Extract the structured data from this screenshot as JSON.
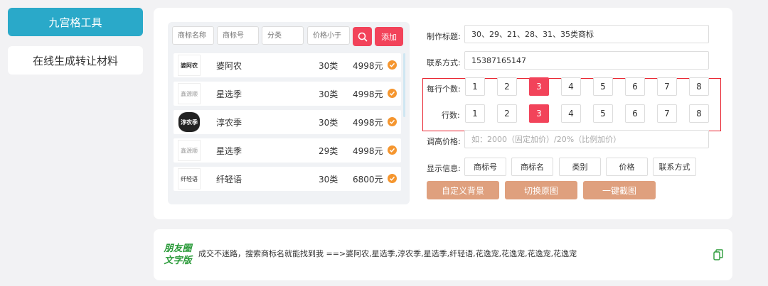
{
  "nav": {
    "grid_tool": "九宫格工具",
    "transfer_material": "在线生成转让材料"
  },
  "search": {
    "name_placeholder": "商标名称",
    "number_placeholder": "商标号",
    "category_placeholder": "分类",
    "price_placeholder": "价格小于",
    "add_label": "添加"
  },
  "trademarks": [
    {
      "logo": "婆阿农",
      "name": "婆阿农",
      "category": "30类",
      "price": "4998元"
    },
    {
      "logo": "鑫源顺",
      "name": "星选季",
      "category": "30类",
      "price": "4998元"
    },
    {
      "logo": "淳农季",
      "name": "淳农季",
      "category": "30类",
      "price": "4998元"
    },
    {
      "logo": "鑫源顺",
      "name": "星选季",
      "category": "29类",
      "price": "4998元"
    },
    {
      "logo": "纤轻语",
      "name": "纤轻语",
      "category": "30类",
      "price": "6800元"
    }
  ],
  "form": {
    "title_label": "制作标题:",
    "title_value": "30、29、21、28、31、35类商标",
    "contact_label": "联系方式:",
    "contact_value": "15387165147",
    "per_row_label": "每行个数:",
    "rows_label": "行数:",
    "numbers": [
      "1",
      "2",
      "3",
      "4",
      "5",
      "6",
      "7",
      "8"
    ],
    "per_row_selected": "3",
    "rows_selected": "3",
    "price_label": "调高价格:",
    "price_placeholder": "如：2000（固定加价）/20%（比例加价）",
    "display_label": "显示信息:",
    "display_options": [
      "商标号",
      "商标名",
      "类别",
      "价格",
      "联系方式"
    ],
    "actions": [
      "自定义背景",
      "切换原图",
      "一键截图"
    ]
  },
  "moments": {
    "badge_line1": "朋友圈",
    "badge_line2": "文字版",
    "text": "成交不迷路，搜索商标名就能找到我 ==>婆阿农,星选季,淳农季,星选季,纤轻语,花逸宠,花逸宠,花逸宠,花逸宠"
  },
  "colors": {
    "nav_active": "#2aa9c9",
    "accent_red": "#f2435a",
    "check_orange": "#f5962f",
    "action_tan": "#dfa07e",
    "badge_green": "#2b9b3a"
  }
}
